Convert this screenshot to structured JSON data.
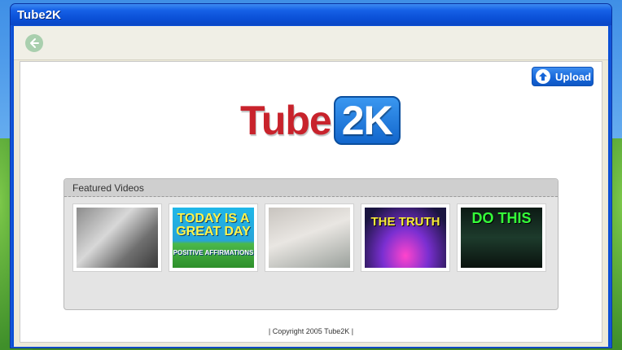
{
  "window": {
    "title": "Tube2K"
  },
  "toolbar": {
    "back_icon": "back-arrow-icon"
  },
  "upload": {
    "label": "Upload",
    "icon": "upload-arrow-icon"
  },
  "logo": {
    "part1": "Tube",
    "part2": "2K",
    "colors": {
      "tube": "#c8232c",
      "badge": "#1266cc"
    }
  },
  "featured": {
    "title": "Featured Videos",
    "thumbnails": [
      {
        "text": "",
        "sub": ""
      },
      {
        "text": "TODAY IS A GREAT DAY",
        "sub": "POSITIVE AFFIRMATIONS"
      },
      {
        "text": "",
        "sub": ""
      },
      {
        "text": "THE TRUTH",
        "sub": ""
      },
      {
        "text": "DO THIS",
        "sub": ""
      }
    ]
  },
  "footer": {
    "copyright": "| Copyright 2005 Tube2K |"
  },
  "colors": {
    "titlebar": "#0a4fd6",
    "accent": "#1565d8"
  }
}
